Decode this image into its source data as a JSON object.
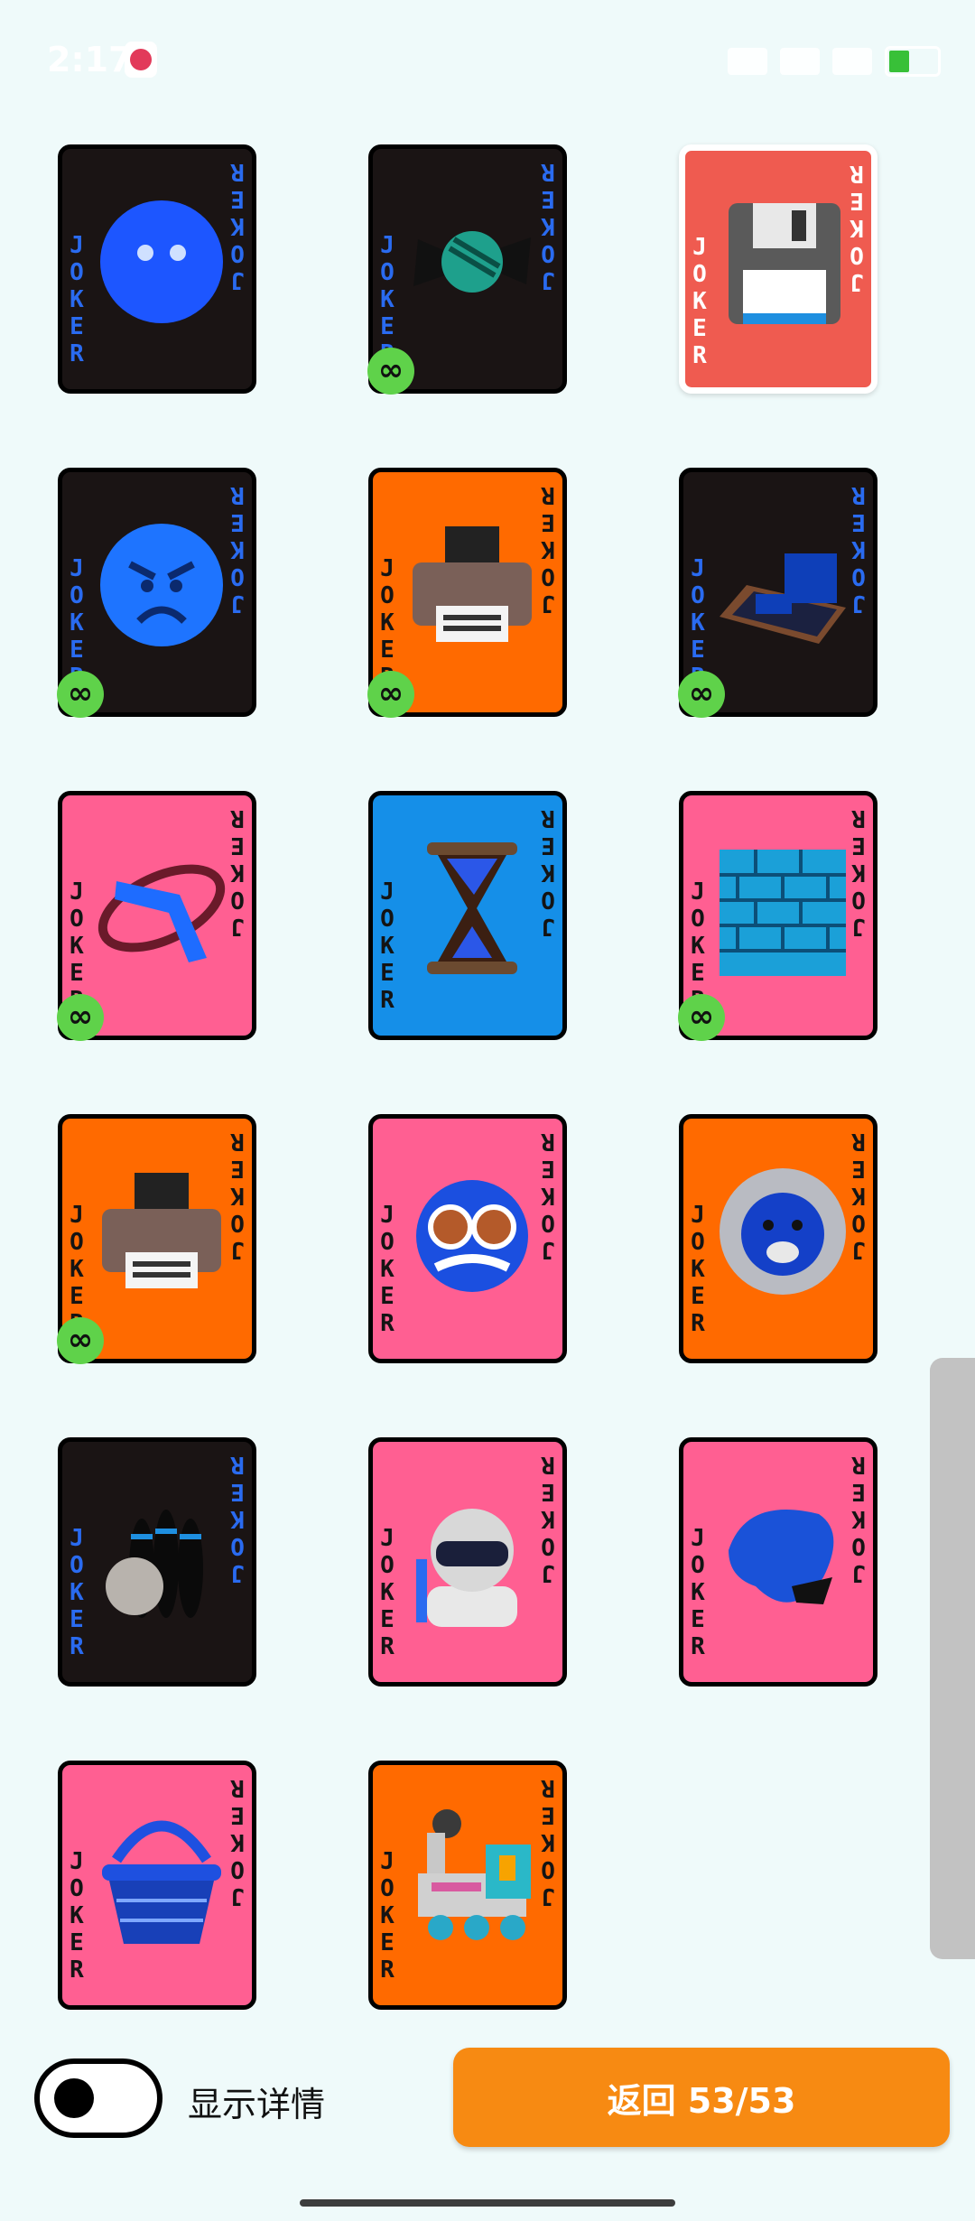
{
  "status_bar": {
    "time": "2:17",
    "icons": [
      "app-icon",
      "nfc-icon",
      "signal-icon",
      "wifi-icon",
      "battery-icon"
    ]
  },
  "joker_text": [
    "J",
    "O",
    "K",
    "E",
    "R"
  ],
  "cards": [
    {
      "bg": "#1a1414",
      "text_color": "blue",
      "art": "blue-face-icon",
      "infinite": false,
      "selected": false
    },
    {
      "bg": "#1a1414",
      "text_color": "blue",
      "art": "candy-icon",
      "infinite": true,
      "selected": false
    },
    {
      "bg": "#ef5b50",
      "text_color": "white",
      "art": "floppy-disk-icon",
      "infinite": false,
      "selected": true
    },
    {
      "bg": "#1a1414",
      "text_color": "blue",
      "art": "angry-face-icon",
      "infinite": true,
      "selected": false
    },
    {
      "bg": "#ff6a00",
      "text_color": "black",
      "art": "printer-icon",
      "infinite": true,
      "selected": false
    },
    {
      "bg": "#1a1414",
      "text_color": "blue",
      "art": "sled-icon",
      "infinite": true,
      "selected": false
    },
    {
      "bg": "#ff5f92",
      "text_color": "black",
      "art": "boomerang-icon",
      "infinite": true,
      "selected": false
    },
    {
      "bg": "#158fe8",
      "text_color": "black",
      "art": "hourglass-icon",
      "infinite": false,
      "selected": false
    },
    {
      "bg": "#ff5f92",
      "text_color": "black",
      "art": "brick-wall-icon",
      "infinite": true,
      "selected": false
    },
    {
      "bg": "#ff6a00",
      "text_color": "black",
      "art": "printer-icon",
      "infinite": true,
      "selected": false
    },
    {
      "bg": "#ff5f92",
      "text_color": "black",
      "art": "disguise-face-icon",
      "infinite": false,
      "selected": false
    },
    {
      "bg": "#ff6a00",
      "text_color": "black",
      "art": "lion-icon",
      "infinite": false,
      "selected": false
    },
    {
      "bg": "#1a1414",
      "text_color": "blue",
      "art": "bowling-icon",
      "infinite": false,
      "selected": false
    },
    {
      "bg": "#ff5f92",
      "text_color": "black",
      "art": "ninja-icon",
      "infinite": false,
      "selected": false
    },
    {
      "bg": "#ff5f92",
      "text_color": "black",
      "art": "fortune-cookie-icon",
      "infinite": false,
      "selected": false
    },
    {
      "bg": "#ff5f92",
      "text_color": "black",
      "art": "basket-icon",
      "infinite": false,
      "selected": false
    },
    {
      "bg": "#ff6a00",
      "text_color": "black",
      "art": "locomotive-icon",
      "infinite": false,
      "selected": false
    }
  ],
  "infinite_symbol": "∞",
  "bottom": {
    "toggle_label": "显示详情",
    "toggle_on": false,
    "return_label": "返回 53/53"
  },
  "colors": {
    "background": "#effafa",
    "accent": "#f78a12",
    "badge": "#5fd24a",
    "joker_blue": "#2a6bf0"
  }
}
